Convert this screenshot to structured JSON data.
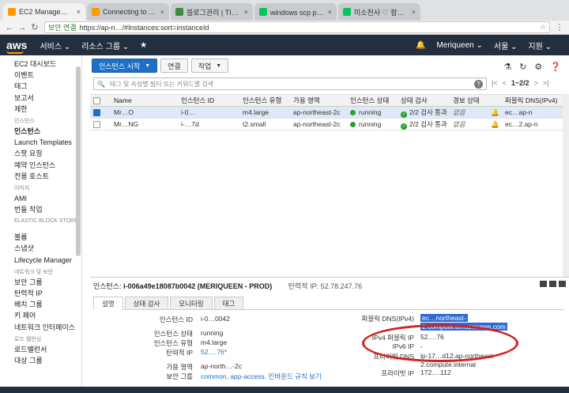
{
  "browser": {
    "tabs": [
      {
        "title": "EC2 Management Conso",
        "color": "#ff9900",
        "active": true
      },
      {
        "title": "Connecting to Your Lin",
        "color": "#ff9900",
        "active": false
      },
      {
        "title": "블로그관리 | TISTORY",
        "color": "#3b8d3b",
        "active": false
      },
      {
        "title": "windows scp ppk : 네이",
        "color": "#03c75a",
        "active": false
      },
      {
        "title": "미소천사 ♡ 팜팜 ~ 텅지",
        "color": "#03c75a",
        "active": false
      }
    ],
    "url_secure": "보안 연결",
    "url": "https://ap-n…/#Instances:sort=instanceId"
  },
  "awsnav": {
    "logo": "aws",
    "services": "서비스 ⌄",
    "resource_groups": "리소스 그룹 ⌄",
    "pin": "★",
    "user": "Meriqueen ⌄",
    "region": "서울 ⌄",
    "support": "지원 ⌄"
  },
  "sidebar": {
    "items": [
      {
        "type": "item",
        "label": "EC2 대시보드"
      },
      {
        "type": "item",
        "label": "이벤트"
      },
      {
        "type": "item",
        "label": "태그"
      },
      {
        "type": "item",
        "label": "보고서"
      },
      {
        "type": "item",
        "label": "제한"
      },
      {
        "type": "section",
        "label": "인스턴스"
      },
      {
        "type": "item",
        "label": "인스턴스",
        "active": true
      },
      {
        "type": "item",
        "label": "Launch Templates"
      },
      {
        "type": "item",
        "label": "스팟 요청"
      },
      {
        "type": "item",
        "label": "예약 인스턴스"
      },
      {
        "type": "item",
        "label": "전용 호스트"
      },
      {
        "type": "section",
        "label": "이미지"
      },
      {
        "type": "item",
        "label": "AMI"
      },
      {
        "type": "item",
        "label": "번들 작업"
      },
      {
        "type": "section2",
        "label": "ELASTIC BLOCK STORE"
      },
      {
        "type": "item",
        "label": "볼륨"
      },
      {
        "type": "item",
        "label": "스냅샷"
      },
      {
        "type": "item",
        "label": "Lifecycle Manager"
      },
      {
        "type": "section",
        "label": "네트워크 및 보안"
      },
      {
        "type": "item",
        "label": "보안 그룹"
      },
      {
        "type": "item",
        "label": "탄력적 IP"
      },
      {
        "type": "item",
        "label": "배치 그룹"
      },
      {
        "type": "item",
        "label": "키 페어"
      },
      {
        "type": "item",
        "label": "네트워크 인터페이스"
      },
      {
        "type": "section",
        "label": "로드 밸런싱"
      },
      {
        "type": "item",
        "label": "로드밸런서"
      },
      {
        "type": "item",
        "label": "대상 그룹"
      }
    ]
  },
  "toolbar": {
    "launch": "인스턴스 시작",
    "connect": "연결",
    "actions": "작업"
  },
  "search": {
    "placeholder": "태그 및 속성별 필터 또는 키워드별 검색",
    "pager": "1~2/2"
  },
  "table": {
    "headers": [
      "Name",
      "인스턴스 ID",
      "인스턴스 유형",
      "가용 영역",
      "인스턴스 상태",
      "상태 검사",
      "경보 상태",
      "",
      "퍼블릭 DNS(IPv4)"
    ],
    "rows": [
      {
        "selected": true,
        "name": "Mr…O",
        "id": "i-0…",
        "type": "m4.large",
        "zone": "ap-northeast-2c",
        "state": "running",
        "check": "2/2 검사 통과",
        "alarm": "없음",
        "dns": "ec…ap-n"
      },
      {
        "selected": false,
        "name": "Mr…NG",
        "id": "i-…7d",
        "type": "t2.small",
        "zone": "ap-northeast-2c",
        "state": "running",
        "check": "2/2 검사 통과",
        "alarm": "없음",
        "dns": "ec…2.ap-n"
      }
    ]
  },
  "detail": {
    "title_prefix": "인스턴스:",
    "title_id": "i-006a49e18087b0042 (MERIQUEEN - PROD)",
    "eip": "탄력적 IP: 52.78.247.76",
    "tabs": [
      "설명",
      "상태 검사",
      "모니터링",
      "태그"
    ],
    "left": [
      {
        "k": "인스턴스 ID",
        "v": "i-0…0042"
      },
      {
        "k": "인스턴스 상태",
        "v": "running"
      },
      {
        "k": "인스턴스 유형",
        "v": "m4.large"
      },
      {
        "k": "탄력적 IP",
        "v": "52.…76*"
      },
      {
        "k": "가용 영역",
        "v": "ap-north…-2c"
      },
      {
        "k": "보안 그룹",
        "v": "common, app-access. 인바운드 규칙 보기"
      }
    ],
    "right": [
      {
        "k": "퍼블릭 DNS(IPv4)",
        "v": "ec…northeast-",
        "v2": "2.compute.amazonaws.com"
      },
      {
        "k": "IPv4 퍼블릭 IP",
        "v": "52.…76"
      },
      {
        "k": "IPv6 IP",
        "v": "-"
      },
      {
        "k": "프라이빗 DNS",
        "v": "ip-17…d12.ap-northeast-",
        "v2": "2.compute.internal"
      },
      {
        "k": "프라이빗 IP",
        "v": "172.…112"
      }
    ]
  }
}
